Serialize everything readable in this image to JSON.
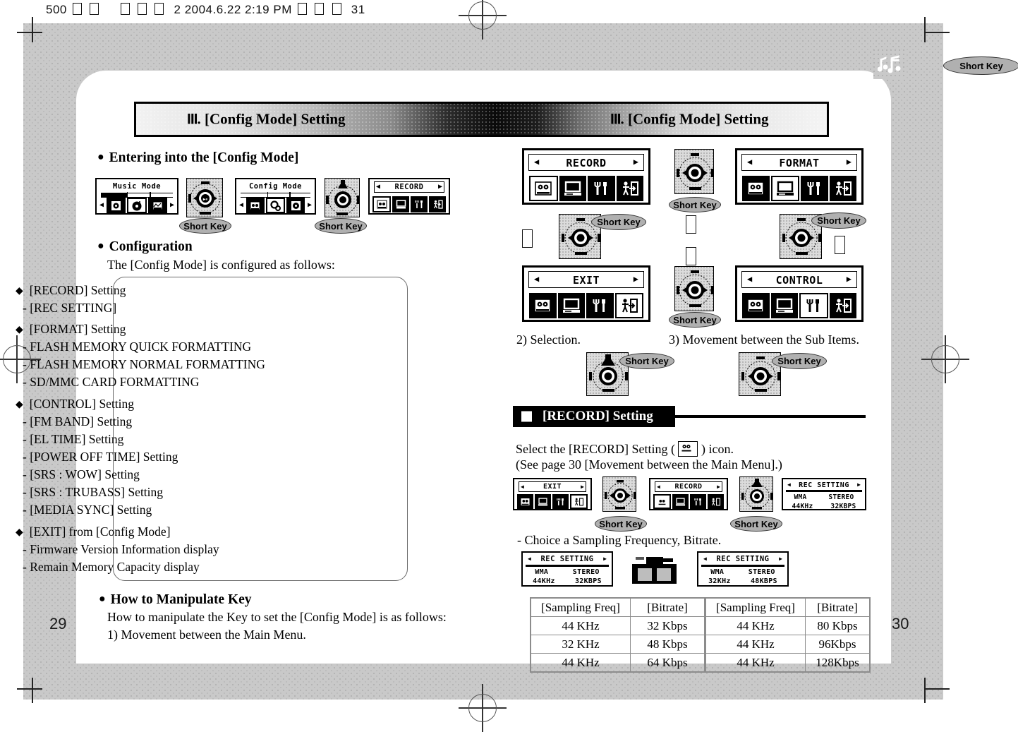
{
  "print_header": {
    "prefix": "500",
    "tofu_count_1": 5,
    "mid": "2  2004.6.22 2:19 PM",
    "tofu_count_2": 3,
    "page": "31"
  },
  "banner": {
    "numeral": "III",
    "left_title": ". [Config Mode] Setting",
    "right_title": ". [Config Mode] Setting"
  },
  "left_page": {
    "page_number": "29",
    "section1_title": "Entering into the [Config Mode]",
    "section2_title": "Configuration",
    "section2_intro": "The [Config Mode] is configured as follows:",
    "config_groups": [
      {
        "head": "[RECORD] Setting",
        "subs": [
          "[REC SETTING]"
        ]
      },
      {
        "head": "[FORMAT] Setting",
        "subs": [
          "FLASH MEMORY QUICK FORMATTING",
          "FLASH MEMORY NORMAL FORMATTING",
          "SD/MMC CARD FORMATTING"
        ]
      },
      {
        "head": "[CONTROL] Setting",
        "subs": [
          "[FM BAND] Setting",
          "[EL TIME] Setting",
          "[POWER OFF TIME] Setting",
          "[SRS : WOW] Setting",
          "[SRS : TRUBASS] Setting",
          "[MEDIA SYNC] Setting"
        ]
      },
      {
        "head": "[EXIT] from [Config Mode]",
        "subs": [
          "Firmware Version Information display",
          "Remain Memory Capacity display"
        ]
      }
    ],
    "section3_title": "How to Manipulate Key",
    "section3_intro": "How to manipulate the Key to set the [Config Mode] is as follows:",
    "step1": "1) Movement between the Main Menu.",
    "flow_screens": [
      {
        "name": "music-mode-screen",
        "title": "Music Mode"
      },
      {
        "name": "nav-wheel-1"
      },
      {
        "name": "config-mode-screen",
        "title": "Config Mode"
      },
      {
        "name": "nav-wheel-2"
      },
      {
        "name": "record-menu-screen",
        "title": "RECORD"
      }
    ],
    "short_key_labels": [
      "Short Key",
      "Short Key"
    ]
  },
  "right_page": {
    "page_number": "30",
    "menu_screens": [
      {
        "name": "record-screen",
        "title": "RECORD",
        "selected": 0
      },
      {
        "name": "format-screen",
        "title": "FORMAT",
        "selected": 1
      },
      {
        "name": "exit-screen",
        "title": "EXIT",
        "selected": 3
      },
      {
        "name": "control-screen",
        "title": "CONTROL",
        "selected": 2
      }
    ],
    "step2": "2) Selection.",
    "step3": "3) Movement between the Sub Items.",
    "short_key_label": "Short Key",
    "record_section": {
      "title": "[RECORD] Setting",
      "line1_a": "Select the [RECORD] Setting (",
      "line1_b": ") icon.",
      "line2": "(See page 30 [Movement between the Main Menu].)",
      "choice_line": "- Choice a Sampling Frequency, Bitrate.",
      "flow_screens": [
        {
          "name": "exit-screen-small",
          "title": "EXIT",
          "selected": 3
        },
        {
          "name": "nav-wheel-3"
        },
        {
          "name": "record-screen-small",
          "title": "RECORD",
          "selected": 0
        },
        {
          "name": "nav-wheel-4"
        }
      ],
      "rec_setting_screen": {
        "title": "REC SETTING",
        "codec": "WMA",
        "channel": "STEREO",
        "freq": "44KHz",
        "bitrate": "32KBPS"
      },
      "rec_setting_before": {
        "title": "REC SETTING",
        "codec": "WMA",
        "channel": "STEREO",
        "freq": "44KHz",
        "bitrate": "32KBPS"
      },
      "rec_setting_after": {
        "title": "REC SETTING",
        "codec": "WMA",
        "channel": "STEREO",
        "freq": "32KHz",
        "bitrate": "48KBPS"
      }
    },
    "table": {
      "headers": [
        "[Sampling Freq]",
        "[Bitrate]",
        "[Sampling Freq]",
        "[Bitrate]"
      ],
      "rows": [
        [
          "44 KHz",
          "32 Kbps",
          "44 KHz",
          "80 Kbps"
        ],
        [
          "32 KHz",
          "48 Kbps",
          "44 KHz",
          "96Kbps"
        ],
        [
          "44 KHz",
          "64 Kbps",
          "44 KHz",
          "128Kbps"
        ]
      ]
    }
  },
  "top_right": {
    "logo_name": "music-note-logo",
    "short_key_label": "Short Key"
  },
  "colors": {
    "paper": "#ffffff",
    "frame_gray": "#c9c9c9",
    "ink": "#000000",
    "shortkey_fill": "#b0b0b0",
    "box_border": "#6a6a6a"
  }
}
